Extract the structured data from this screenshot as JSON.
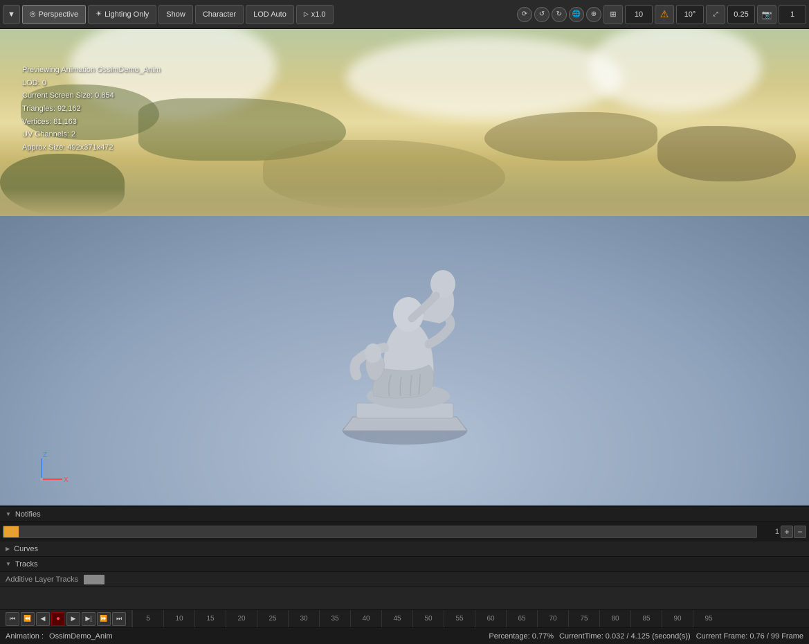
{
  "toolbar": {
    "dropdown_label": "▼",
    "perspective_label": "Perspective",
    "lighting_label": "Lighting Only",
    "show_label": "Show",
    "character_label": "Character",
    "lod_label": "LOD Auto",
    "scale_label": "x1.0",
    "right_icons": [
      "⟳",
      "↺",
      "↻",
      "🌐",
      "⊕",
      "⊞"
    ],
    "num1": "10",
    "num2": "10°",
    "num3": "0.25",
    "num4": "1"
  },
  "info": {
    "line1": "Previewing Animation OssimDemo_Anim",
    "line2": "LOD: 0",
    "line3": "Current Screen Size: 0.854",
    "line4": "Triangles: 92,162",
    "line5": "Vertices: 81,163",
    "line6": "UV Channels: 2",
    "line7": "Approx Size: 492x371x472"
  },
  "bottom": {
    "notifies_label": "Notifies",
    "curves_label": "Curves",
    "tracks_label": "Tracks",
    "additive_label": "Additive Layer Tracks",
    "timeline_number": "1",
    "animation_label": "Animation :",
    "animation_name": "OssimDemo_Anim",
    "status_percentage": "Percentage:  0.77%",
    "status_current": "CurrentTime:  0.032 / 4.125 (second(s))",
    "status_frame": "Current Frame:  0.76 / 99 Frame"
  },
  "frame_ticks": [
    "5",
    "10",
    "15",
    "20",
    "25",
    "30",
    "35",
    "40",
    "45",
    "50",
    "55",
    "60",
    "65",
    "70",
    "75",
    "80",
    "85",
    "90",
    "95"
  ]
}
